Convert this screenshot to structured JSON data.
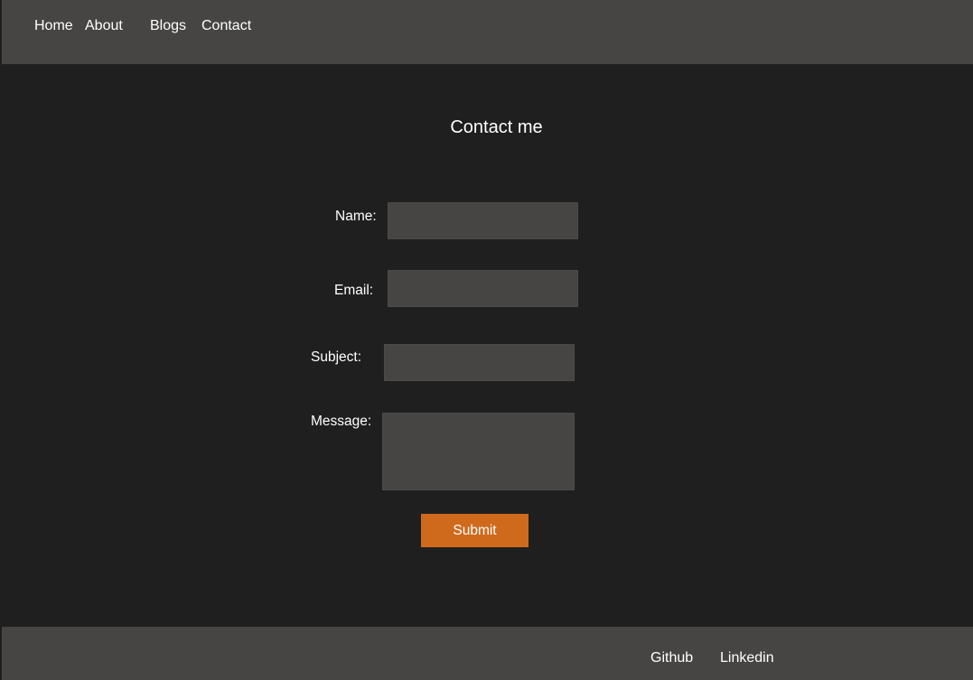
{
  "nav": {
    "items": [
      {
        "label": "Home"
      },
      {
        "label": "About"
      },
      {
        "label": "Blogs"
      },
      {
        "label": "Contact"
      }
    ]
  },
  "page": {
    "title": "Contact me"
  },
  "form": {
    "name": {
      "label": "Name:",
      "value": ""
    },
    "email": {
      "label": "Email:",
      "value": ""
    },
    "subject": {
      "label": "Subject:",
      "value": ""
    },
    "message": {
      "label": "Message:",
      "value": ""
    },
    "submit_label": "Submit"
  },
  "footer": {
    "links": [
      {
        "label": "Github"
      },
      {
        "label": "Linkedin"
      }
    ]
  },
  "colors": {
    "bar_background": "#464544",
    "page_background": "#1f1f1f",
    "input_background": "#464544",
    "accent": "#cf6a1c",
    "text": "#ffffff"
  }
}
